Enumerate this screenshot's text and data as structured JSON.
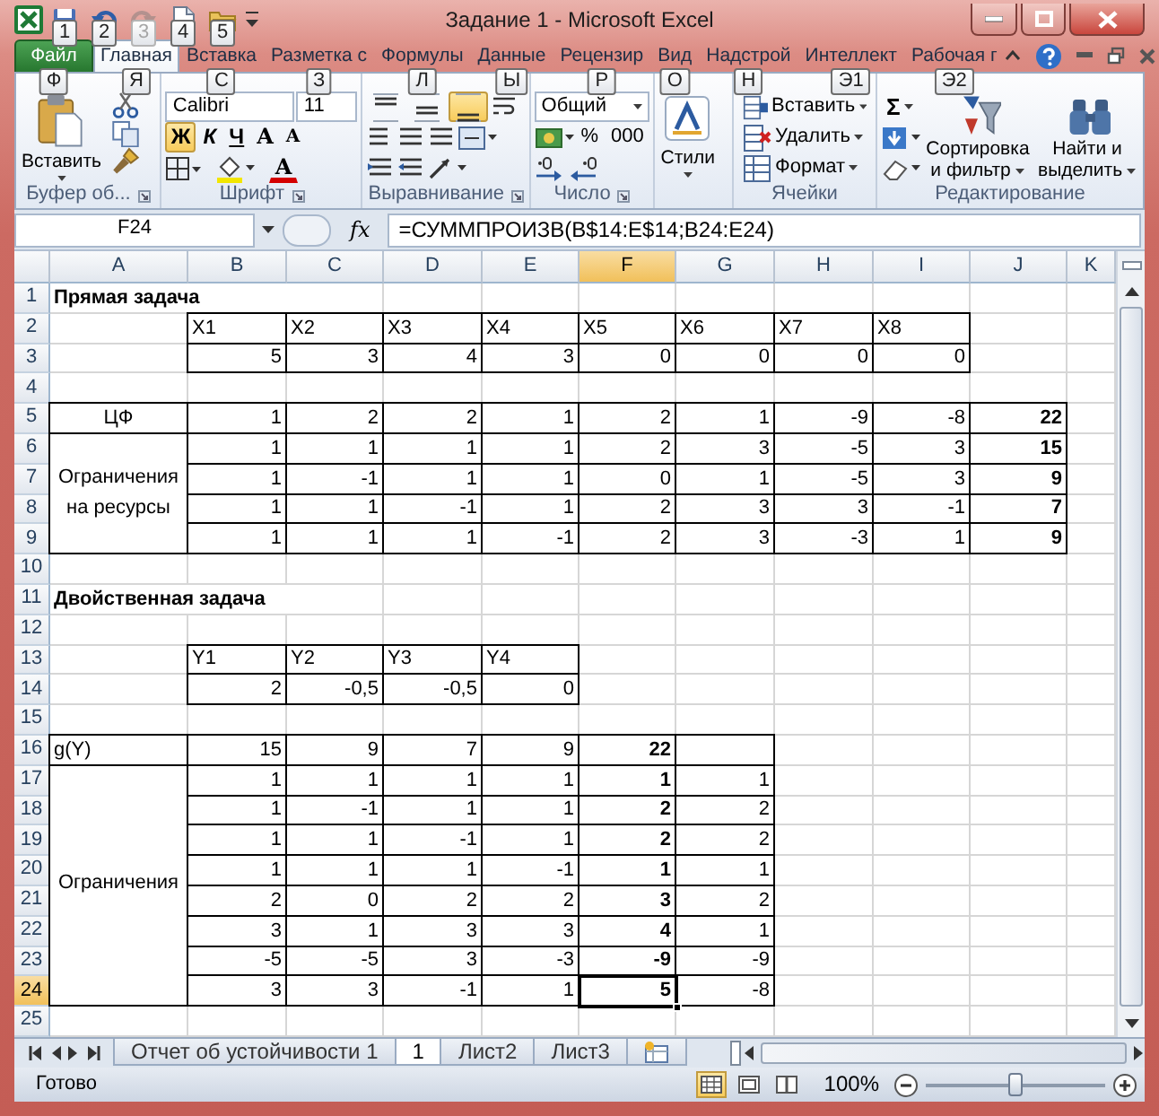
{
  "window": {
    "title": "Задание 1  -  Microsoft Excel"
  },
  "quick_access": [
    {
      "kind": "save",
      "keytip": "1",
      "disabled": false
    },
    {
      "kind": "undo",
      "keytip": "2",
      "disabled": false
    },
    {
      "kind": "redo",
      "keytip": "3",
      "disabled": true
    },
    {
      "kind": "new",
      "keytip": "4",
      "disabled": false
    },
    {
      "kind": "open",
      "keytip": "5",
      "disabled": false
    }
  ],
  "tabs": [
    {
      "kind": "file",
      "label": "Файл",
      "keytip": "Ф",
      "selected": false
    },
    {
      "kind": "tab",
      "label": "Главная",
      "keytip": "Я",
      "selected": true
    },
    {
      "kind": "tab",
      "label": "Вставка",
      "keytip": "С",
      "selected": false
    },
    {
      "kind": "tab",
      "label": "Разметка с",
      "keytip": "З",
      "selected": false
    },
    {
      "kind": "tab",
      "label": "Формулы",
      "keytip": "Л",
      "selected": false
    },
    {
      "kind": "tab",
      "label": "Данные",
      "keytip": "Ы",
      "selected": false
    },
    {
      "kind": "tab",
      "label": "Рецензир",
      "keytip": "Р",
      "selected": false
    },
    {
      "kind": "tab",
      "label": "Вид",
      "keytip": "О",
      "selected": false
    },
    {
      "kind": "tab",
      "label": "Надстрой",
      "keytip": "Н",
      "selected": false
    },
    {
      "kind": "tab",
      "label": "Интеллект",
      "keytip": "Э1",
      "selected": false
    },
    {
      "kind": "tab",
      "label": "Рабочая г",
      "keytip": "Э2",
      "selected": false
    }
  ],
  "ribbon": {
    "clipboard": {
      "paste": "Вставить",
      "label": "Буфер об..."
    },
    "font": {
      "name": "Calibri",
      "size": "11",
      "styles": [
        {
          "label": "Ж",
          "on": true
        },
        {
          "label": "К",
          "on": false
        },
        {
          "label": "Ч",
          "on": false
        }
      ],
      "grow": "A",
      "shrink": "A",
      "color_button": "A",
      "label": "Шрифт"
    },
    "alignment": {
      "vertical": [
        {
          "on": false
        },
        {
          "on": false
        },
        {
          "on": true
        }
      ],
      "label": "Выравнивание"
    },
    "number": {
      "format": "Общий",
      "percent": "%",
      "thousands": "000",
      "label": "Число"
    },
    "styles": {
      "button": "Стили"
    },
    "cells": {
      "buttons": [
        "Вставить",
        "Удалить",
        "Формат"
      ],
      "label": "Ячейки"
    },
    "editing": {
      "sum": "Σ",
      "sort": "Сортировка и фильтр",
      "find": "Найти и выделить",
      "label": "Редактирование"
    }
  },
  "formula_bar": {
    "name_box": "F24",
    "fx": "fx",
    "formula": "=СУММПРОИЗВ(B$14:E$14;B24:E24)"
  },
  "columns": [
    {
      "label": "A",
      "selected": false
    },
    {
      "label": "B",
      "selected": false
    },
    {
      "label": "C",
      "selected": false
    },
    {
      "label": "D",
      "selected": false
    },
    {
      "label": "E",
      "selected": false
    },
    {
      "label": "F",
      "selected": true
    },
    {
      "label": "G",
      "selected": false
    },
    {
      "label": "H",
      "selected": false
    },
    {
      "label": "I",
      "selected": false
    },
    {
      "label": "J",
      "selected": false
    },
    {
      "label": "K",
      "selected": false
    }
  ],
  "rows": [
    {
      "header": "1",
      "selected": false,
      "cells": [
        {
          "text": "Прямая задача",
          "kind": "title"
        }
      ]
    },
    {
      "header": "2",
      "selected": false,
      "cells": [
        null,
        {
          "text": "X1",
          "kind": "label"
        },
        {
          "text": "X2",
          "kind": "label"
        },
        {
          "text": "X3",
          "kind": "label"
        },
        {
          "text": "X4",
          "kind": "label"
        },
        {
          "text": "X5",
          "kind": "label"
        },
        {
          "text": "X6",
          "kind": "label"
        },
        {
          "text": "X7",
          "kind": "label"
        },
        {
          "text": "X8",
          "kind": "label"
        }
      ]
    },
    {
      "header": "3",
      "selected": false,
      "cells": [
        null,
        "5",
        "3",
        "4",
        "3",
        "0",
        "0",
        "0",
        "0"
      ]
    },
    {
      "header": "4",
      "selected": false
    },
    {
      "header": "5",
      "selected": false,
      "cells": [
        {
          "text": "ЦФ",
          "kind": "center"
        },
        "1",
        "2",
        "2",
        "1",
        "2",
        "1",
        "-9",
        "-8",
        {
          "text": "22",
          "kind": "total"
        }
      ]
    },
    {
      "header": "6",
      "selected": false,
      "cells": [
        {
          "text": "Ограничения на ресурсы",
          "kind": "merged"
        },
        "1",
        "1",
        "1",
        "1",
        "2",
        "3",
        "-5",
        "3",
        {
          "text": "15",
          "kind": "total"
        }
      ]
    },
    {
      "header": "7",
      "selected": false,
      "cells": [
        null,
        "1",
        "-1",
        "1",
        "1",
        "0",
        "1",
        "-5",
        "3",
        {
          "text": "9",
          "kind": "total"
        }
      ]
    },
    {
      "header": "8",
      "selected": false,
      "cells": [
        null,
        "1",
        "1",
        "-1",
        "1",
        "2",
        "3",
        "3",
        "-1",
        {
          "text": "7",
          "kind": "total"
        }
      ]
    },
    {
      "header": "9",
      "selected": false,
      "cells": [
        null,
        "1",
        "1",
        "1",
        "-1",
        "2",
        "3",
        "-3",
        "1",
        {
          "text": "9",
          "kind": "total"
        }
      ]
    },
    {
      "header": "10",
      "selected": false
    },
    {
      "header": "11",
      "selected": false,
      "cells": [
        {
          "text": "Двойственная задача",
          "kind": "title"
        }
      ]
    },
    {
      "header": "12",
      "selected": false
    },
    {
      "header": "13",
      "selected": false,
      "cells": [
        null,
        {
          "text": "Y1",
          "kind": "label"
        },
        {
          "text": "Y2",
          "kind": "label"
        },
        {
          "text": "Y3",
          "kind": "label"
        },
        {
          "text": "Y4",
          "kind": "label"
        }
      ]
    },
    {
      "header": "14",
      "selected": false,
      "cells": [
        null,
        "2",
        "-0,5",
        "-0,5",
        "0"
      ]
    },
    {
      "header": "15",
      "selected": false
    },
    {
      "header": "16",
      "selected": false,
      "cells": [
        {
          "text": "g(Y)",
          "kind": "label"
        },
        "15",
        "9",
        "7",
        "9",
        {
          "text": "22",
          "kind": "total"
        }
      ]
    },
    {
      "header": "17",
      "selected": false,
      "cells": [
        {
          "text": "Ограничения",
          "kind": "merged"
        },
        "1",
        "1",
        "1",
        "1",
        {
          "text": "1",
          "kind": "total"
        },
        "1"
      ]
    },
    {
      "header": "18",
      "selected": false,
      "cells": [
        null,
        "1",
        "-1",
        "1",
        "1",
        {
          "text": "2",
          "kind": "total"
        },
        "2"
      ]
    },
    {
      "header": "19",
      "selected": false,
      "cells": [
        null,
        "1",
        "1",
        "-1",
        "1",
        {
          "text": "2",
          "kind": "total"
        },
        "2"
      ]
    },
    {
      "header": "20",
      "selected": false,
      "cells": [
        null,
        "1",
        "1",
        "1",
        "-1",
        {
          "text": "1",
          "kind": "total"
        },
        "1"
      ]
    },
    {
      "header": "21",
      "selected": false,
      "cells": [
        null,
        "2",
        "0",
        "2",
        "2",
        {
          "text": "3",
          "kind": "total"
        },
        "2"
      ]
    },
    {
      "header": "22",
      "selected": false,
      "cells": [
        null,
        "3",
        "1",
        "3",
        "3",
        {
          "text": "4",
          "kind": "total"
        },
        "1"
      ]
    },
    {
      "header": "23",
      "selected": false,
      "cells": [
        null,
        "-5",
        "-5",
        "3",
        "-3",
        {
          "text": "-9",
          "kind": "total"
        },
        "-9"
      ]
    },
    {
      "header": "24",
      "selected": true,
      "cells": [
        null,
        "3",
        "3",
        "-1",
        "1",
        {
          "text": "5",
          "kind": "total"
        },
        "-8"
      ]
    },
    {
      "header": "25",
      "selected": false
    }
  ],
  "sheet_tabs": [
    {
      "label": "Отчет об устойчивости 1",
      "selected": false
    },
    {
      "label": "1",
      "selected": true
    },
    {
      "label": "Лист2",
      "selected": false
    },
    {
      "label": "Лист3",
      "selected": false
    }
  ],
  "status_bar": {
    "text": "Готово",
    "views": [
      {
        "kind": "normal",
        "selected": true
      },
      {
        "kind": "layout",
        "selected": false
      },
      {
        "kind": "pagebreak",
        "selected": false
      }
    ],
    "zoom": "100%",
    "level": 0.5
  }
}
